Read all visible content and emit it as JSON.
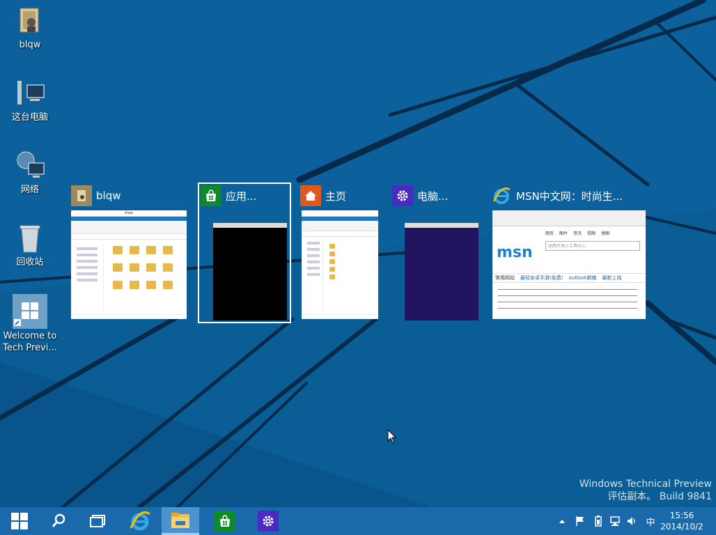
{
  "desktop": {
    "icons": [
      {
        "name": "blqw",
        "icon": "user-folder-icon"
      },
      {
        "name": "这台电脑",
        "icon": "computer-icon"
      },
      {
        "name": "网络",
        "icon": "network-icon"
      },
      {
        "name": "回收站",
        "icon": "recycle-bin-icon"
      },
      {
        "name": "Welcome to Tech Previ...",
        "icon": "windows-shortcut-icon"
      }
    ]
  },
  "task_switcher": {
    "items": [
      {
        "title": "blqw",
        "icon": "explorer-folder-icon",
        "selected": false
      },
      {
        "title": "应用...",
        "icon": "store-icon",
        "selected": true
      },
      {
        "title": "主页",
        "icon": "home-icon",
        "selected": false
      },
      {
        "title": "电脑...",
        "icon": "pc-settings-icon",
        "selected": false
      },
      {
        "title": "MSN中文网：时尚生...",
        "icon": "internet-explorer-icon",
        "selected": false
      }
    ],
    "thumb_blqw": {
      "window_title": "blqw"
    },
    "thumb_msn": {
      "logo": "msn",
      "search_placeholder": "由两开发小工具中心",
      "links": [
        "网页",
        "图片",
        "资讯",
        "视频",
        "地图"
      ],
      "nav": [
        "常用网站",
        "最轻安卓手游(免费)",
        "outlook邮箱",
        "最新上线"
      ]
    }
  },
  "watermark": {
    "line1": "Windows Technical Preview",
    "line2": "评估副本。 Build 9841"
  },
  "taskbar": {
    "buttons": [
      {
        "name": "start",
        "icon": "windows-logo-icon"
      },
      {
        "name": "search",
        "icon": "search-icon"
      },
      {
        "name": "task-view",
        "icon": "task-view-icon"
      },
      {
        "name": "internet-explorer",
        "icon": "internet-explorer-icon"
      },
      {
        "name": "file-explorer",
        "icon": "file-explorer-icon",
        "active": true
      },
      {
        "name": "store",
        "icon": "store-icon"
      },
      {
        "name": "pc-settings",
        "icon": "settings-gear-icon"
      }
    ],
    "tray": {
      "ime": "中",
      "time": "15:56",
      "date": "2014/10/2"
    }
  },
  "colors": {
    "desktop_bg": "#0b5d96",
    "taskbar": "#1a6aab",
    "store_tile": "#0e8a2b",
    "home_tile": "#e0571f",
    "settings_tile": "#4a2ac0",
    "settings_thumb": "#22135e"
  }
}
